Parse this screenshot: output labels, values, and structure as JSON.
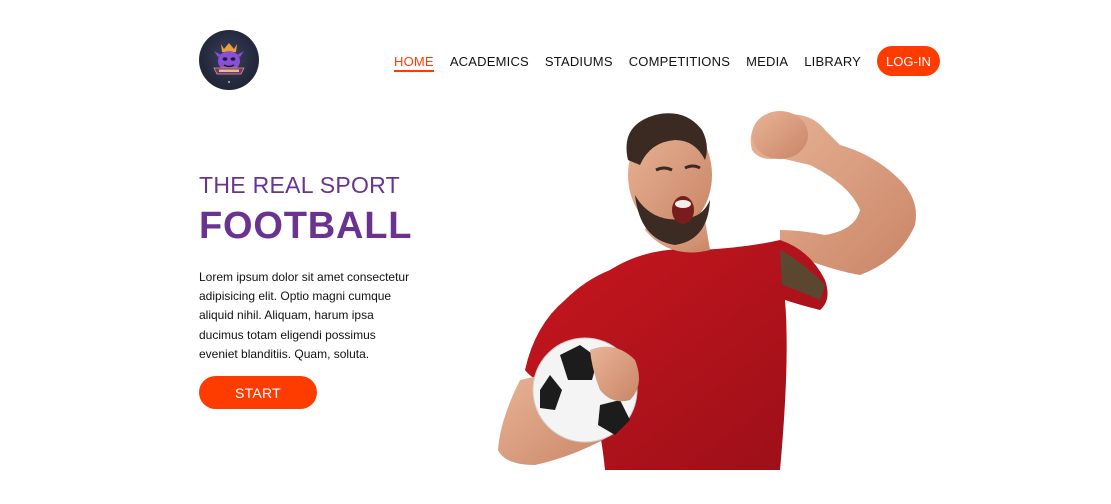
{
  "logo": {
    "icon": "team-crest-logo"
  },
  "nav": {
    "items": [
      {
        "label": "HOME",
        "active": true
      },
      {
        "label": "ACADEMICS",
        "active": false
      },
      {
        "label": "STADIUMS",
        "active": false
      },
      {
        "label": "COMPETITIONS",
        "active": false
      },
      {
        "label": "MEDIA",
        "active": false
      },
      {
        "label": "LIBRARY",
        "active": false
      }
    ],
    "login_label": "LOG-IN"
  },
  "hero": {
    "subtitle": "THE REAL SPORT",
    "title": "FOOTBALL",
    "description": "Lorem ipsum dolor sit amet consectetur adipisicing elit. Optio magni cumque aliquid nihil. Aliquam, harum ipsa ducimus totam eligendi possimus eveniet blanditiis. Quam, soluta.",
    "start_label": "START",
    "image": "football-player-celebrating-with-ball"
  },
  "colors": {
    "accent": "#ff3c00",
    "title": "#6a3390",
    "jersey": "#b3141d"
  }
}
